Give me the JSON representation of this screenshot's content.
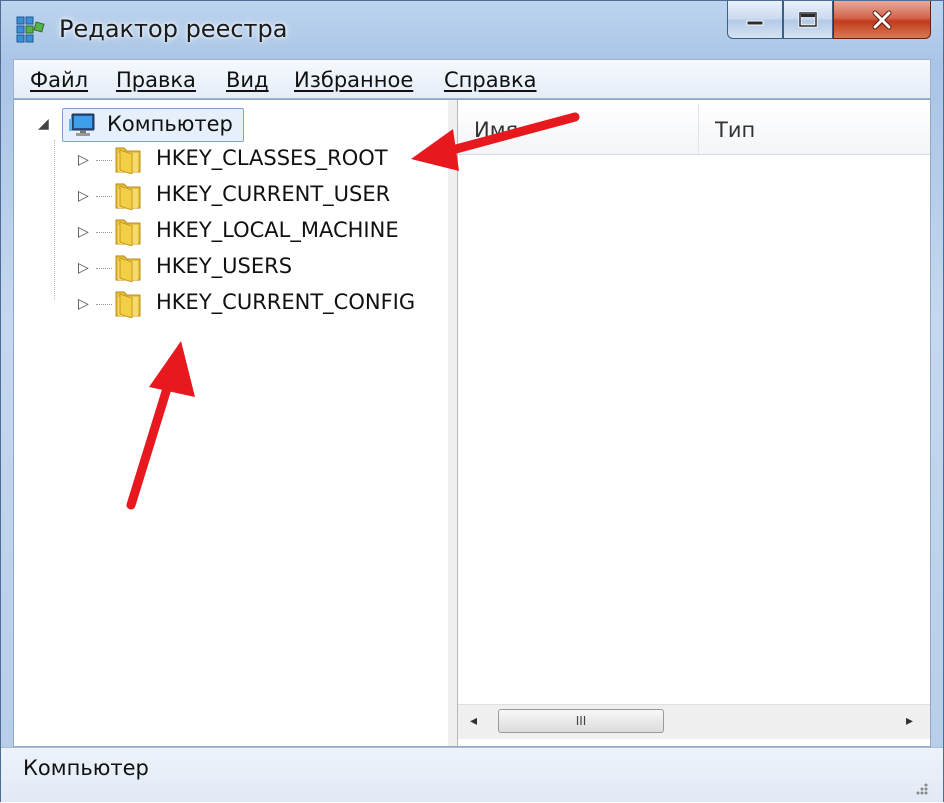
{
  "window": {
    "title": "Редактор реестра",
    "app_icon": "registry-editor-icon",
    "caption_buttons": {
      "minimize": "minimize-icon",
      "maximize": "maximize-icon",
      "close": "close-icon"
    }
  },
  "menu": {
    "items": [
      {
        "label": "Файл"
      },
      {
        "label": "Правка"
      },
      {
        "label": "Вид"
      },
      {
        "label": "Избранное"
      },
      {
        "label": "Справка"
      }
    ]
  },
  "tree": {
    "root": {
      "label": "Компьютер",
      "icon": "computer-icon",
      "expanded": true
    },
    "items": [
      {
        "label": "HKEY_CLASSES_ROOT",
        "icon": "folder-icon"
      },
      {
        "label": "HKEY_CURRENT_USER",
        "icon": "folder-icon"
      },
      {
        "label": "HKEY_LOCAL_MACHINE",
        "icon": "folder-icon"
      },
      {
        "label": "HKEY_USERS",
        "icon": "folder-icon"
      },
      {
        "label": "HKEY_CURRENT_CONFIG",
        "icon": "folder-icon"
      }
    ]
  },
  "list": {
    "columns": [
      {
        "label": "Имя"
      },
      {
        "label": "Тип"
      }
    ],
    "scroll_thumb_glyph": "III"
  },
  "status": {
    "text": "Компьютер"
  },
  "colors": {
    "annotation_arrow": "#e8181f",
    "selection_border": "#7da2ce",
    "close_button": "#c23a1e"
  }
}
